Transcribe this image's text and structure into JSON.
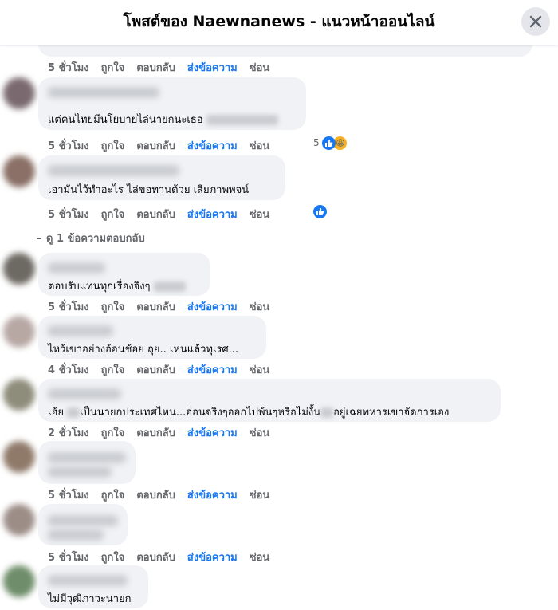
{
  "header": {
    "title": "โพสต์ของ Naewnanews - แนวหน้าออนไลน์"
  },
  "actions": {
    "like": "ถูกใจ",
    "reply": "ตอบกลับ",
    "send": "ส่งข้อความ",
    "hide": "ซ่อน"
  },
  "comments": [
    {
      "text": "",
      "time": "5 ชั่วโมง"
    },
    {
      "text": "แต่คนไทยมีนโยบายไล่นายกนะเธอ",
      "time": "5 ชั่วโมง",
      "reactions": "5"
    },
    {
      "text": "เอามันไว้ทำอะไร ไล่ขอทานด้วย เสียภาพพจน์",
      "time": "5 ชั่วโมง"
    },
    {
      "text": "ตอบรับแทนทุกเรื่องจิงๆ",
      "time": "5 ชั่วโมง"
    },
    {
      "text": "ไหว้เขาอย่างอ้อนช้อย ถุย.. เหนแล้วทุเรศ...",
      "time": "4 ชั่วโมง"
    },
    {
      "text_a": "เฮ้ย",
      "text_b": "เป็นนายกประเทศไหน...อ่อนจริงๆออกไปพ้นๆหรือไม่งั้น",
      "text_c": "อยู่เฉยทหารเขาจัดการเอง",
      "time": "2 ชั่วโมง"
    },
    {
      "text": "",
      "time": "5 ชั่วโมง"
    },
    {
      "text": "",
      "time": "5 ชั่วโมง"
    },
    {
      "text": "ไม่มีวุฒิภาวะนายก"
    }
  ],
  "more_replies": "ดู 1 ข้อความตอบกลับ",
  "colors": {
    "accent": "#1877f2",
    "bubble": "#f0f2f5",
    "meta": "#65676b"
  },
  "icons": {
    "close": "close-icon",
    "like": "like-reaction-icon",
    "haha": "haha-reaction-icon"
  }
}
